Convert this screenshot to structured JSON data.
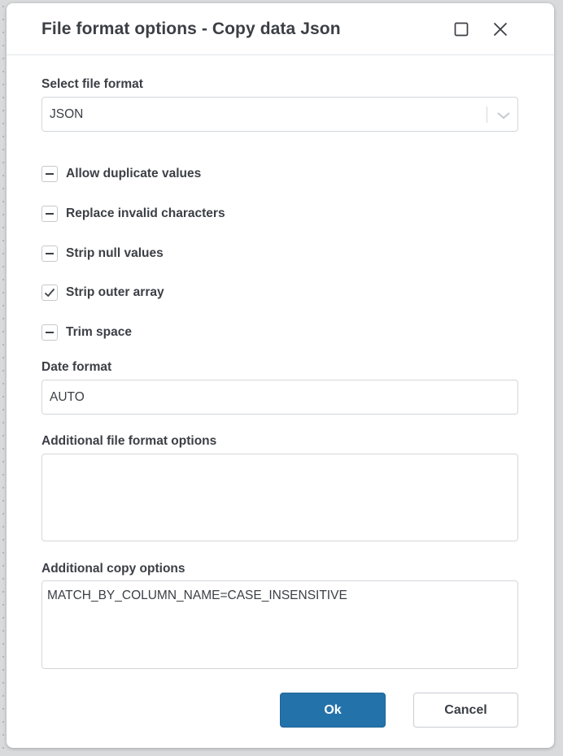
{
  "dialog": {
    "title": "File format options - Copy data Json"
  },
  "file_format": {
    "label": "Select file format",
    "selected": "JSON",
    "icon": "chevron-down-icon"
  },
  "checkboxes": [
    {
      "label": "Allow duplicate values",
      "state": "indeterminate"
    },
    {
      "label": "Replace invalid characters",
      "state": "indeterminate"
    },
    {
      "label": "Strip null values",
      "state": "indeterminate"
    },
    {
      "label": "Strip outer array",
      "state": "checked"
    },
    {
      "label": "Trim space",
      "state": "indeterminate"
    }
  ],
  "date_format": {
    "label": "Date format",
    "value": "AUTO"
  },
  "additional_file_format": {
    "label": "Additional file format options",
    "value": ""
  },
  "additional_copy": {
    "label": "Additional copy options",
    "value": "MATCH_BY_COLUMN_NAME=CASE_INSENSITIVE"
  },
  "buttons": {
    "ok": "Ok",
    "cancel": "Cancel"
  },
  "colors": {
    "primary": "#2472aa",
    "text": "#3b3f45",
    "border": "#d3d7db"
  }
}
